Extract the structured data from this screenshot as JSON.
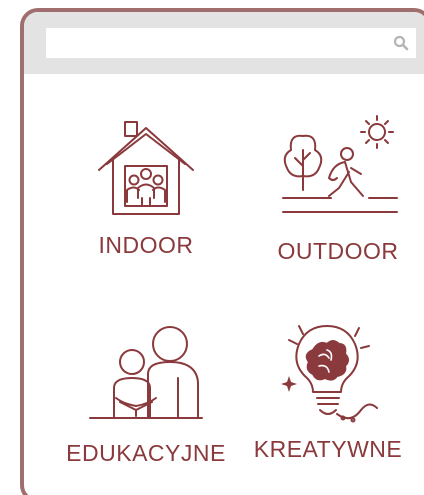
{
  "search": {
    "value": "",
    "placeholder": "",
    "icon": "search-icon"
  },
  "colors": {
    "accent": "#8a3a3c",
    "frame": "#a06e6e",
    "search_band": "#e3e3e3"
  },
  "categories": [
    {
      "label": "INDOOR",
      "icon": "house-family-icon"
    },
    {
      "label": "OUTDOOR",
      "icon": "walking-tree-sun-icon"
    },
    {
      "label": "EDUKACYJNE",
      "icon": "parent-child-reading-icon"
    },
    {
      "label": "KREATYWNE",
      "icon": "creative-lightbulb-brain-icon"
    }
  ]
}
